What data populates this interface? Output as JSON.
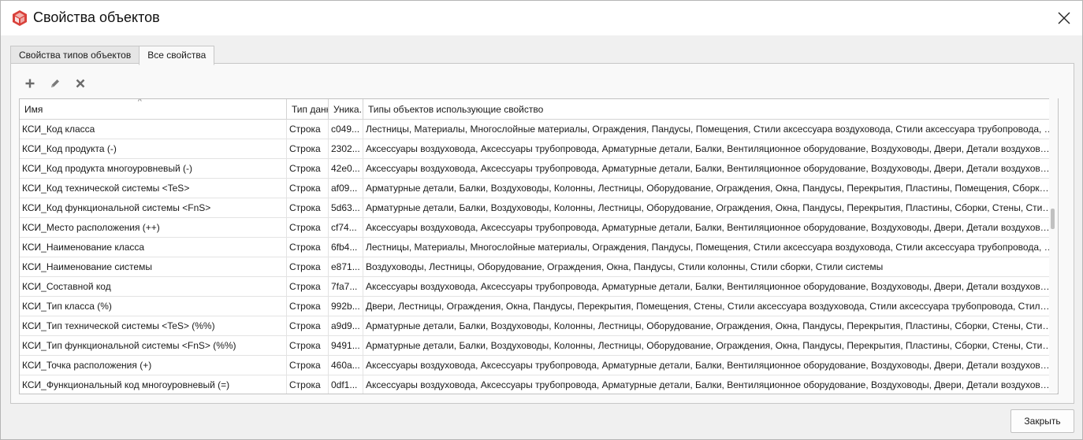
{
  "window": {
    "title": "Свойства объектов"
  },
  "tabs": [
    {
      "label": "Свойства типов объектов",
      "active": false
    },
    {
      "label": "Все свойства",
      "active": true
    }
  ],
  "toolbar": {
    "add_icon": "plus-icon",
    "edit_icon": "pencil-icon",
    "delete_icon": "x-icon"
  },
  "table": {
    "columns": [
      "Имя",
      "Тип данн",
      "Уника...",
      "Типы объектов использующие свойство"
    ],
    "rows": [
      {
        "name": "КСИ_Код класса",
        "type": "Строка",
        "uid": "c049...",
        "types": "Лестницы, Материалы, Многослойные материалы, Ограждения, Пандусы, Помещения, Стили аксессуара воздуховода, Стили аксессуара трубопровода, Ст..."
      },
      {
        "name": "КСИ_Код продукта (-)",
        "type": "Строка",
        "uid": "2302...",
        "types": "Аксессуары воздуховода, Аксессуары трубопровода, Арматурные детали, Балки, Вентиляционное оборудование, Воздуховоды, Двери, Детали воздуховода,..."
      },
      {
        "name": "КСИ_Код продукта многоуровневый (-)",
        "type": "Строка",
        "uid": "42e0...",
        "types": "Аксессуары воздуховода, Аксессуары трубопровода, Арматурные детали, Балки, Вентиляционное оборудование, Воздуховоды, Двери, Детали воздуховода,..."
      },
      {
        "name": "КСИ_Код технической системы <TeS>",
        "type": "Строка",
        "uid": "af09...",
        "types": "Арматурные детали, Балки, Воздуховоды, Колонны, Лестницы, Оборудование, Ограждения, Окна, Пандусы, Перекрытия, Пластины, Помещения, Сборки, ..."
      },
      {
        "name": "КСИ_Код функциональной системы <FnS>",
        "type": "Строка",
        "uid": "5d63...",
        "types": "Арматурные детали, Балки, Воздуховоды, Колонны, Лестницы, Оборудование, Ограждения, Окна, Пандусы, Перекрытия, Пластины, Сборки, Стены, Стили ..."
      },
      {
        "name": "КСИ_Место расположения (++)",
        "type": "Строка",
        "uid": "cf74...",
        "types": "Аксессуары воздуховода, Аксессуары трубопровода, Арматурные детали, Балки, Вентиляционное оборудование, Воздуховоды, Двери, Детали воздуховода,..."
      },
      {
        "name": "КСИ_Наименование класса",
        "type": "Строка",
        "uid": "6fb4...",
        "types": "Лестницы, Материалы, Многослойные материалы, Ограждения, Пандусы, Помещения, Стили аксессуара воздуховода, Стили аксессуара трубопровода, Ст..."
      },
      {
        "name": "КСИ_Наименование системы",
        "type": "Строка",
        "uid": "e871...",
        "types": "Воздуховоды, Лестницы, Оборудование, Ограждения, Окна, Пандусы, Стили колонны, Стили сборки, Стили системы"
      },
      {
        "name": "КСИ_Составной код",
        "type": "Строка",
        "uid": "7fa7...",
        "types": "Аксессуары воздуховода, Аксессуары трубопровода, Арматурные детали, Балки, Вентиляционное оборудование, Воздуховоды, Двери, Детали воздуховода,..."
      },
      {
        "name": "КСИ_Тип класса (%)",
        "type": "Строка",
        "uid": "992b...",
        "types": "Двери, Лестницы, Ограждения, Окна, Пандусы, Перекрытия, Помещения, Стены, Стили аксессуара воздуховода, Стили аксессуара трубопровода, Стили ар..."
      },
      {
        "name": "КСИ_Тип технической системы <TeS> (%%)",
        "type": "Строка",
        "uid": "a9d9...",
        "types": "Арматурные детали, Балки, Воздуховоды, Колонны, Лестницы, Оборудование, Ограждения, Окна, Пандусы, Перекрытия, Пластины, Сборки, Стены, Стили ..."
      },
      {
        "name": "КСИ_Тип функциональной системы <FnS> (%%)",
        "type": "Строка",
        "uid": "9491...",
        "types": "Арматурные детали, Балки, Воздуховоды, Колонны, Лестницы, Оборудование, Ограждения, Окна, Пандусы, Перекрытия, Пластины, Сборки, Стены, Стили ..."
      },
      {
        "name": "КСИ_Точка расположения (+)",
        "type": "Строка",
        "uid": "460a...",
        "types": "Аксессуары воздуховода, Аксессуары трубопровода, Арматурные детали, Балки, Вентиляционное оборудование, Воздуховоды, Двери, Детали воздуховода,..."
      },
      {
        "name": "КСИ_Функциональный код многоуровневый (=)",
        "type": "Строка",
        "uid": "0df1...",
        "types": "Аксессуары воздуховода, Аксессуары трубопровода, Арматурные детали, Балки, Вентиляционное оборудование, Воздуховоды, Двери, Детали воздуховода,..."
      }
    ]
  },
  "footer": {
    "close_label": "Закрыть"
  },
  "colors": {
    "accent_icon": "#d9413b"
  }
}
